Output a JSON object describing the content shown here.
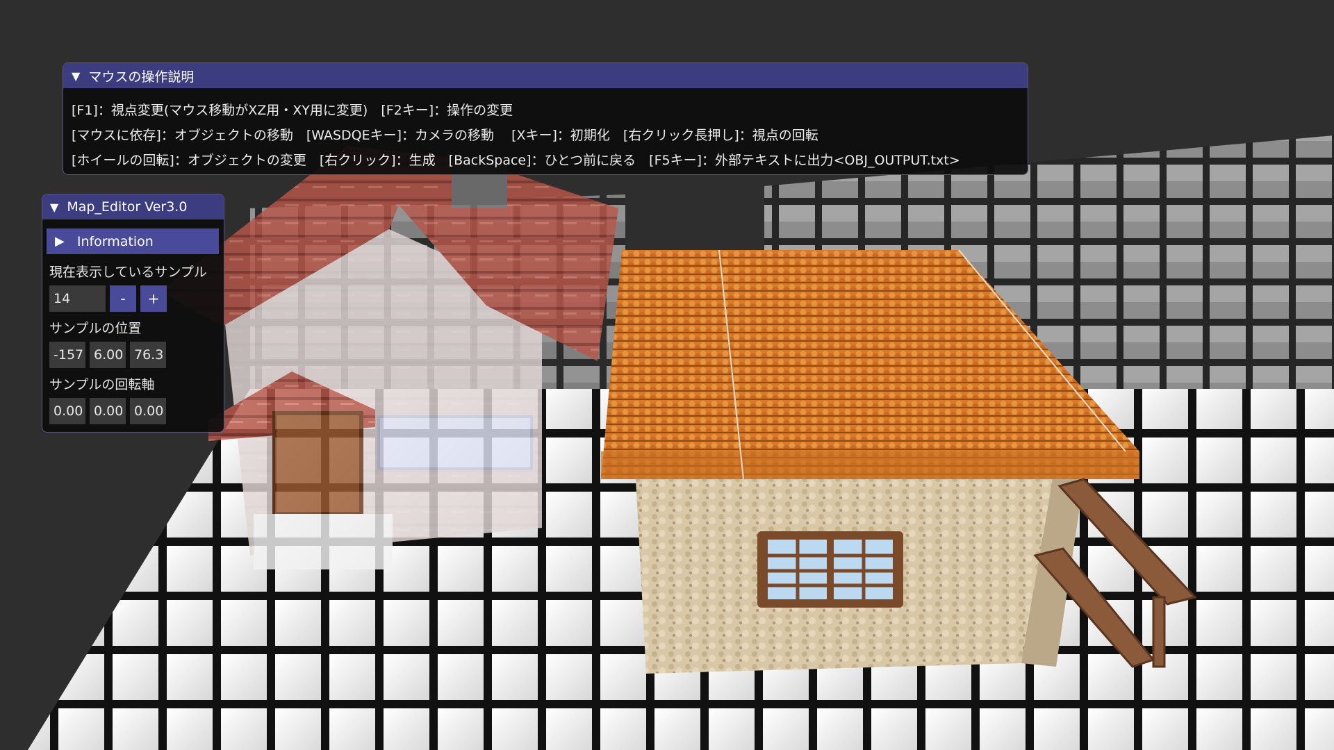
{
  "mouse_help": {
    "title": "マウスの操作説明",
    "lines": [
      "[F1]：視点変更(マウス移動がXZ用・XY用に変更)　[F2キー]：操作の変更",
      "[マウスに依存]：オブジェクトの移動　[WASDQEキー]：カメラの移動　 [Xキー]：初期化　[右クリック長押し]：視点の回転",
      "[ホイールの回転]：オブジェクトの変更　[右クリック]：生成　[BackSpace]：ひとつ前に戻る　[F5キー]：外部テキストに出力<OBJ_OUTPUT.txt>"
    ]
  },
  "editor": {
    "title": "Map_Editor Ver3.0",
    "info_header": "Information",
    "sample_label": "現在表示しているサンプル",
    "sample_value": "14",
    "minus_label": "-",
    "plus_label": "+",
    "position_label": "サンプルの位置",
    "position_values": [
      "-157",
      "6.00",
      "76.3"
    ],
    "rotation_label": "サンプルの回転軸",
    "rotation_values": [
      "0.00",
      "0.00",
      "0.00"
    ]
  },
  "icons": {
    "collapse": "triangle-down-icon",
    "expand": "triangle-right-icon"
  },
  "colors": {
    "title_bar": "#3c3c80",
    "header": "#4a4a9a",
    "background": "#2e2e2e"
  }
}
